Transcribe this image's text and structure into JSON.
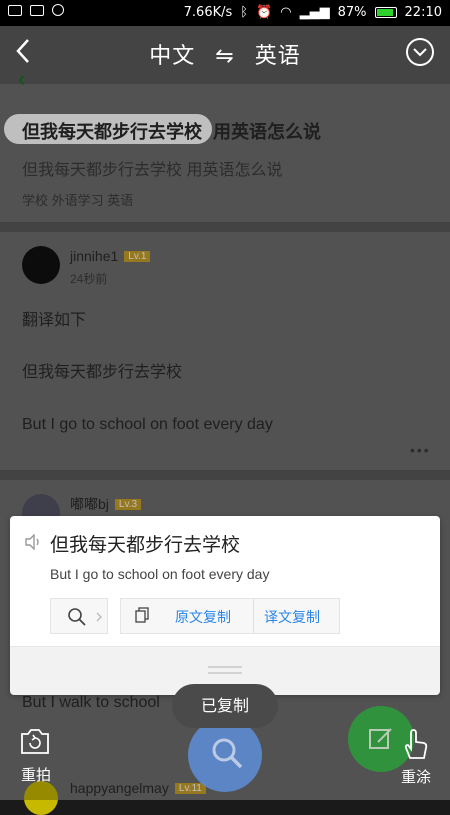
{
  "status_bar": {
    "speed": "7.66K/s",
    "signal1": "॰॰",
    "battery_percent": "87%",
    "time": "22:10"
  },
  "header": {
    "source_lang": "中文",
    "swap": "⇋",
    "target_lang": "英语"
  },
  "background_page": {
    "question_title": "但我每天都步行去学校",
    "question_suffix": "用英语怎么说",
    "question_subtitle": "但我每天都步行去学校 用英语怎么说",
    "tags": "学校  外语学习  英语",
    "answers": [
      {
        "user": "jinnihe1",
        "level": "Lv.1",
        "time": "24秒前",
        "lines": [
          "翻译如下",
          "",
          "但我每天都步行去学校",
          "",
          "But I go to school on foot every day"
        ]
      },
      {
        "user": "嘟嘟bj",
        "level": "Lv.3",
        "partial_line": "But I walk to school"
      },
      {
        "user": "happyangelmay",
        "level": "Lv.11"
      }
    ]
  },
  "result_card": {
    "source_text": "但我每天都步行去学校",
    "translated_text": "But I go to school on foot every day",
    "copy_source_label": "原文复制",
    "copy_translation_label": "译文复制"
  },
  "toast": {
    "text": "已复制"
  },
  "bottom": {
    "retake_label": "重拍",
    "repaint_label": "重涂"
  },
  "icons": [
    "back-icon",
    "chevron-down-icon",
    "speaker-icon",
    "search-icon",
    "copy-icon",
    "camera-search-icon",
    "retake-icon",
    "hand-icon",
    "edit-icon"
  ]
}
